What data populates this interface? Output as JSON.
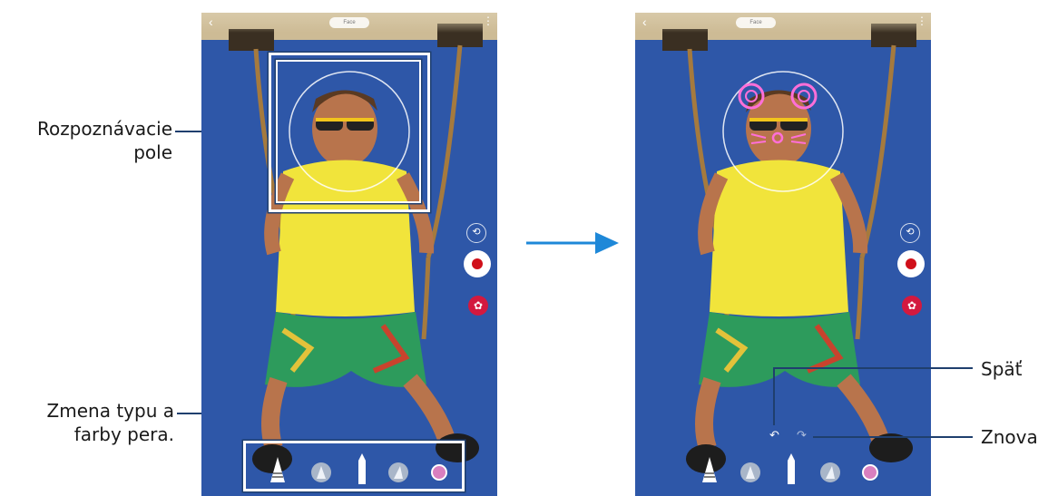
{
  "callouts": {
    "recognition_field": {
      "line1": "Rozpoznávacie",
      "line2": "pole"
    },
    "pen_change": {
      "line1": "Zmena typu a",
      "line2": "farby pera."
    },
    "undo": "Späť",
    "redo": "Znova"
  },
  "screens": {
    "before": {
      "mode_label": "Face",
      "back_icon": "back-arrow-icon",
      "more_icon": "more-vert-icon"
    },
    "after": {
      "mode_label": "Face",
      "back_icon": "back-arrow-icon",
      "more_icon": "more-vert-icon"
    }
  },
  "icons": {
    "switch_camera": "⟲",
    "sticker": "✿",
    "undo": "↶",
    "redo": "↷",
    "back": "‹",
    "more": "⋮"
  },
  "colors": {
    "callout_line": "#1f3f6e",
    "arrow": "#1e88d8",
    "record_dot": "#d0101a",
    "sticker_button": "#d3193f",
    "pen_color": "#d97fbf",
    "drawing_neon": "#ff6fd8"
  }
}
